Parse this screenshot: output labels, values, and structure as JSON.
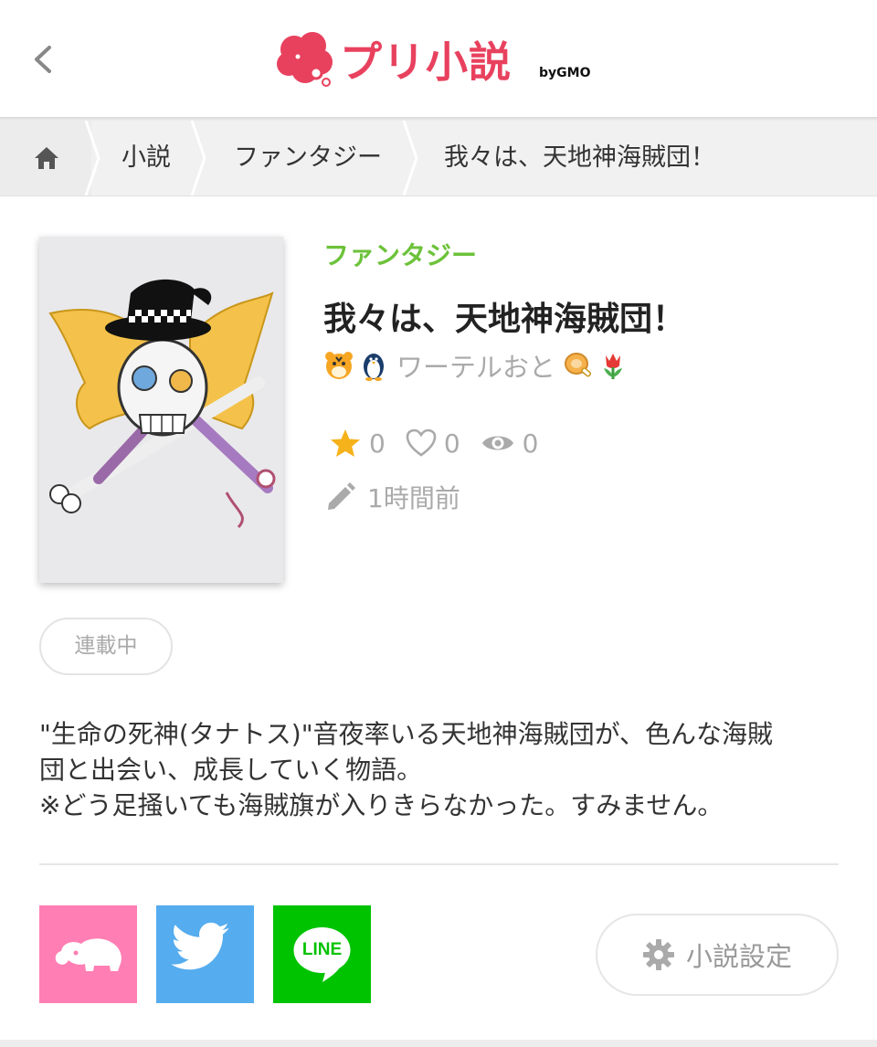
{
  "header": {
    "logo_text": "プリ小説",
    "logo_by": "byGMO",
    "back_icon": "chevron-left-icon",
    "brand_color": "#e8415e"
  },
  "breadcrumb": {
    "home_icon": "home-icon",
    "items": [
      "小説",
      "ファンタジー",
      "我々は、天地神海賊団！"
    ]
  },
  "novel": {
    "genre": "ファンタジー",
    "genre_color": "#6cc23a",
    "title": "我々は、天地神海賊団！",
    "author": "ワーテルおと",
    "stats": {
      "stars": "0",
      "likes": "0",
      "views": "0"
    },
    "updated": "1時間前",
    "status": "連載中",
    "description": [
      "\"生命の死神(タナトス)\"音夜率いる天地神海賊団が、色んな海賊",
      "団と出会い、成長していく物語。",
      "※どう足掻いても海賊旗が入りきらなかった。すみません。"
    ]
  },
  "share": {
    "buttons": [
      {
        "icon": "elephant-icon",
        "color": "#ff7eb3"
      },
      {
        "icon": "twitter-bird-icon",
        "color": "#55acee"
      },
      {
        "icon": "line-icon",
        "color": "#00c300",
        "label": "LINE"
      }
    ]
  },
  "settings": {
    "label": "小説設定",
    "icon": "gear-icon"
  }
}
